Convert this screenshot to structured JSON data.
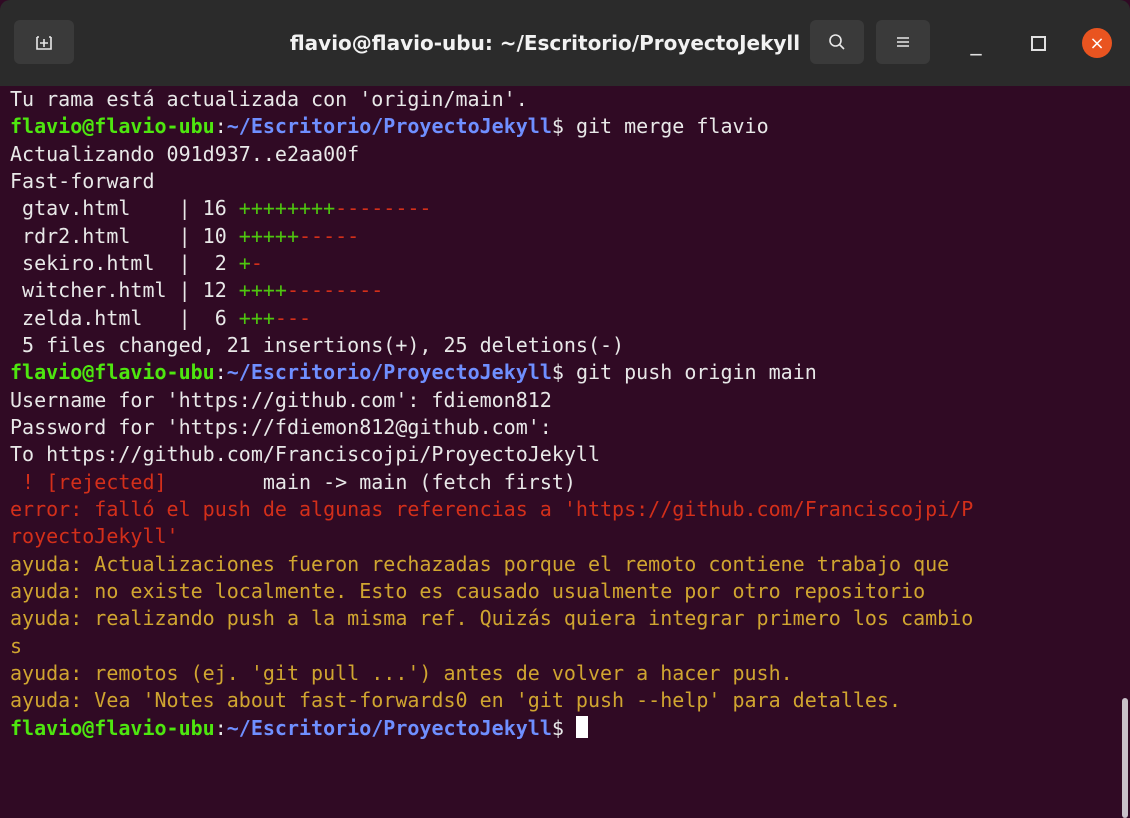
{
  "window": {
    "title": "flavio@flavio-ubu: ~/Escritorio/ProyectoJekyll"
  },
  "titlebar": {
    "new_tab_icon": "plus-box-icon",
    "search_icon": "search-icon",
    "menu_icon": "hamburger-icon",
    "min_glyph": "_",
    "close_glyph": "×"
  },
  "colors": {
    "prompt_user": "#4ee60f",
    "prompt_path": "#6f8fff",
    "error": "#d32f1a",
    "hint": "#d0a530",
    "background": "#300a24"
  },
  "prompt": {
    "user": "flavio@flavio-ubu",
    "colon": ":",
    "path": "~/Escritorio/ProyectoJekyll",
    "sign": "$ "
  },
  "lines": [
    "Tu rama está actualizada con 'origin/main'.",
    "git merge flavio",
    "Actualizando 091d937..e2aa00f",
    "Fast-forward",
    " gtav.html    | 16 ",
    "++++++++",
    "--------",
    " rdr2.html    | 10 ",
    "+++++",
    "-----",
    " sekiro.html  |  2 ",
    "+",
    "-",
    " witcher.html | 12 ",
    "++++",
    "--------",
    " zelda.html   |  6 ",
    "+++",
    "---",
    " 5 files changed, 21 insertions(+), 25 deletions(-)",
    "git push origin main",
    "Username for 'https://github.com': fdiemon812",
    "Password for 'https://fdiemon812@github.com':",
    "To https://github.com/Franciscojpi/ProyectoJekyll",
    " ! [rejected]",
    "        main -> main (fetch first)",
    "error: falló el push de algunas referencias a 'https://github.com/Franciscojpi/P",
    "royectoJekyll'",
    "ayuda: Actualizaciones fueron rechazadas porque el remoto contiene trabajo que",
    "ayuda: no existe localmente. Esto es causado usualmente por otro repositorio",
    "ayuda: realizando push a la misma ref. Quizás quiera integrar primero los cambio",
    "s",
    "ayuda: remotos (ej. 'git pull ...') antes de volver a hacer push.",
    "ayuda: Vea 'Notes about fast-forwards0 en 'git push --help' para detalles."
  ]
}
